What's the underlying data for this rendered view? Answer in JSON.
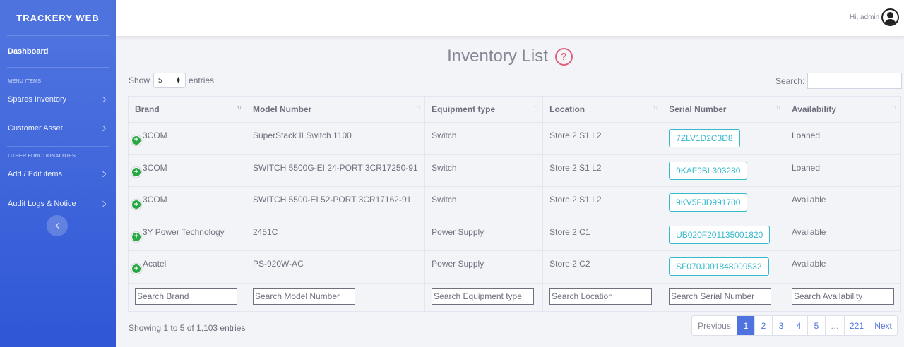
{
  "sidebar": {
    "brand": "TRACKERY WEB",
    "dashboard": "Dashboard",
    "heading_menu": "MENU ITEMS",
    "items_menu": [
      "Spares Inventory",
      "Customer Asset"
    ],
    "heading_other": "OTHER FUNCTIONALITIES",
    "items_other": [
      "Add / Edit items",
      "Audit Logs & Notice"
    ]
  },
  "topbar": {
    "greeting": "Hi, admin"
  },
  "page": {
    "title": "Inventory List",
    "help_glyph": "?"
  },
  "controls": {
    "show_label": "Show",
    "entries_label": "entries",
    "length_value": "5",
    "search_label": "Search:",
    "search_value": ""
  },
  "table": {
    "columns": [
      "Brand",
      "Model Number",
      "Equipment type",
      "Location",
      "Serial Number",
      "Availability"
    ],
    "rows": [
      {
        "brand": "3COM",
        "model": "SuperStack II Switch 1100",
        "type": "Switch",
        "location": "Store 2 S1 L2",
        "serial": "7ZLV1D2C3D8",
        "availability": "Loaned"
      },
      {
        "brand": "3COM",
        "model": "SWITCH 5500G-EI 24-PORT 3CR17250-91",
        "type": "Switch",
        "location": "Store 2 S1 L2",
        "serial": "9KAF9BL303280",
        "availability": "Loaned"
      },
      {
        "brand": "3COM",
        "model": "SWITCH 5500-EI 52-PORT 3CR17162-91",
        "type": "Switch",
        "location": "Store 2 S1 L2",
        "serial": "9KV5FJD991700",
        "availability": "Available"
      },
      {
        "brand": "3Y Power Technology",
        "model": "2451C",
        "type": "Power Supply",
        "location": "Store 2 C1",
        "serial": "UB020F201135001820",
        "availability": "Available"
      },
      {
        "brand": "Acatel",
        "model": "PS-920W-AC",
        "type": "Power Supply",
        "location": "Store 2 C2",
        "serial": "SF070J001848009532",
        "availability": "Available"
      }
    ],
    "filters": [
      "Search Brand",
      "Search Model Number",
      "Search Equipment type",
      "Search Location",
      "Search Serial Number",
      "Search Availability"
    ]
  },
  "footer": {
    "info": "Showing 1 to 5 of 1,103 entries",
    "pagination": [
      "Previous",
      "1",
      "2",
      "3",
      "4",
      "5",
      "…",
      "221",
      "Next"
    ],
    "current_page": "1"
  },
  "colors": {
    "sidebar": "#4e73df",
    "accent": "#4e73df",
    "serial_outline": "#36b9cc",
    "expand_green": "#28a745",
    "help_pink": "#e0607e"
  },
  "icons": {
    "expand": "plus-circle-icon",
    "sort": "sort-arrows-icon",
    "help": "question-circle-icon",
    "avatar": "user-avatar-icon"
  }
}
